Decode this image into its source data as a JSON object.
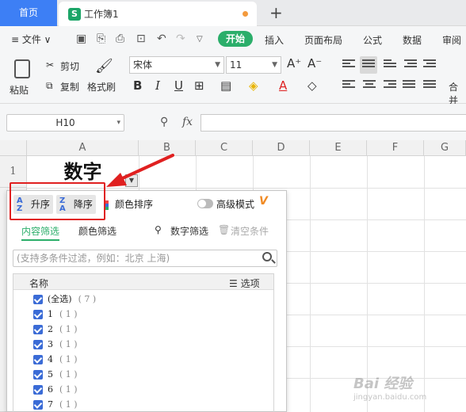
{
  "titlebar": {
    "home_tab": "首页",
    "doc_icon": "S",
    "doc_name": "工作簿1",
    "new_tab": "+"
  },
  "menu": {
    "file": "≡ 文件 ∨",
    "start": "开始",
    "tabs": [
      "插入",
      "页面布局",
      "公式",
      "数据",
      "审阅"
    ]
  },
  "ribbon": {
    "paste": "粘贴",
    "cut": "剪切",
    "copy": "复制",
    "format_painter": "格式刷",
    "font_name": "宋体",
    "font_size": "11",
    "grow": "A⁺",
    "shrink": "A⁻",
    "bold": "B",
    "italic": "I",
    "underline": "U",
    "merge": "合并"
  },
  "formula": {
    "name_box": "H10",
    "fx": "fx"
  },
  "grid": {
    "columns": [
      "A",
      "B",
      "C",
      "D",
      "E",
      "F",
      "G"
    ],
    "rows": [
      "1"
    ],
    "cell_a1": "数字"
  },
  "filter": {
    "sort_asc": "升序",
    "sort_desc": "降序",
    "color_sort": "颜色排序",
    "advanced_mode": "高级模式",
    "vip": "V",
    "tab_content": "内容筛选",
    "tab_color": "颜色筛选",
    "number_filter": "数字筛选",
    "clear": "清空条件",
    "search_placeholder": "(支持多条件过滤，例如：北京 上海)",
    "list_header_name": "名称",
    "list_header_options": "☰ 选项",
    "items": [
      {
        "label": "(全选)",
        "count": "( 7 )"
      },
      {
        "label": "1",
        "count": "( 1 )"
      },
      {
        "label": "2",
        "count": "( 1 )"
      },
      {
        "label": "3",
        "count": "( 1 )"
      },
      {
        "label": "4",
        "count": "( 1 )"
      },
      {
        "label": "5",
        "count": "( 1 )"
      },
      {
        "label": "6",
        "count": "( 1 )"
      },
      {
        "label": "7",
        "count": "( 1 )"
      }
    ]
  },
  "watermark": {
    "text": "Bai 经验",
    "sub": "jingyan.baidu.com"
  },
  "colors": {
    "accent_green": "#2bae6a",
    "home_blue": "#3d7ff5",
    "highlight_red": "#e02020"
  }
}
